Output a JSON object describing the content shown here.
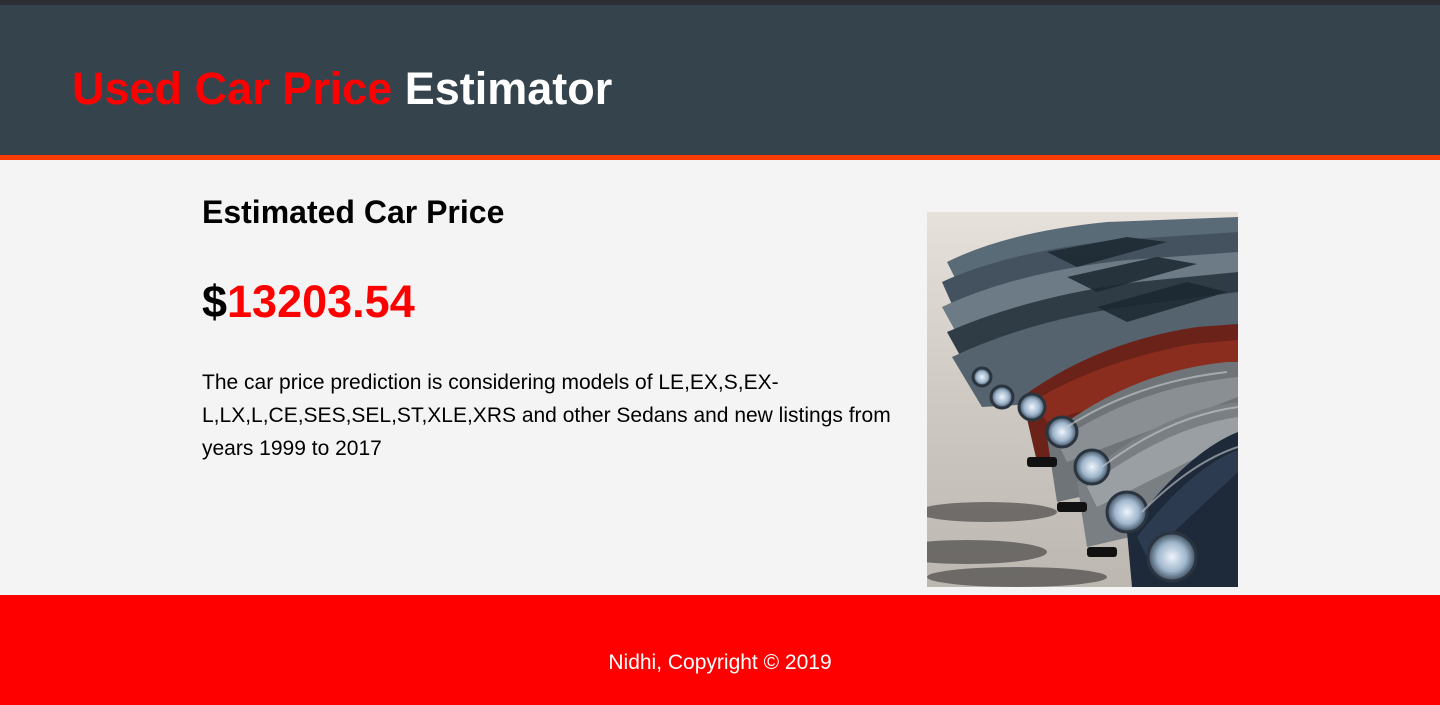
{
  "header": {
    "title_highlight": "Used Car Price",
    "title_rest": "Estimator"
  },
  "result": {
    "heading": "Estimated Car Price",
    "currency": "$",
    "value": "13203.54",
    "description": "The car price prediction is considering models of LE,EX,S,EX-L,LX,L,CE,SES,SEL,ST,XLE,XRS and other Sedans and new listings from years 1999 to 2017"
  },
  "footer": {
    "text": "Nidhi, Copyright © 2019"
  },
  "colors": {
    "header_bg": "#35444c",
    "accent": "#ff0000",
    "header_underline": "#ff3b00",
    "page_bg": "#f4f4f4"
  }
}
